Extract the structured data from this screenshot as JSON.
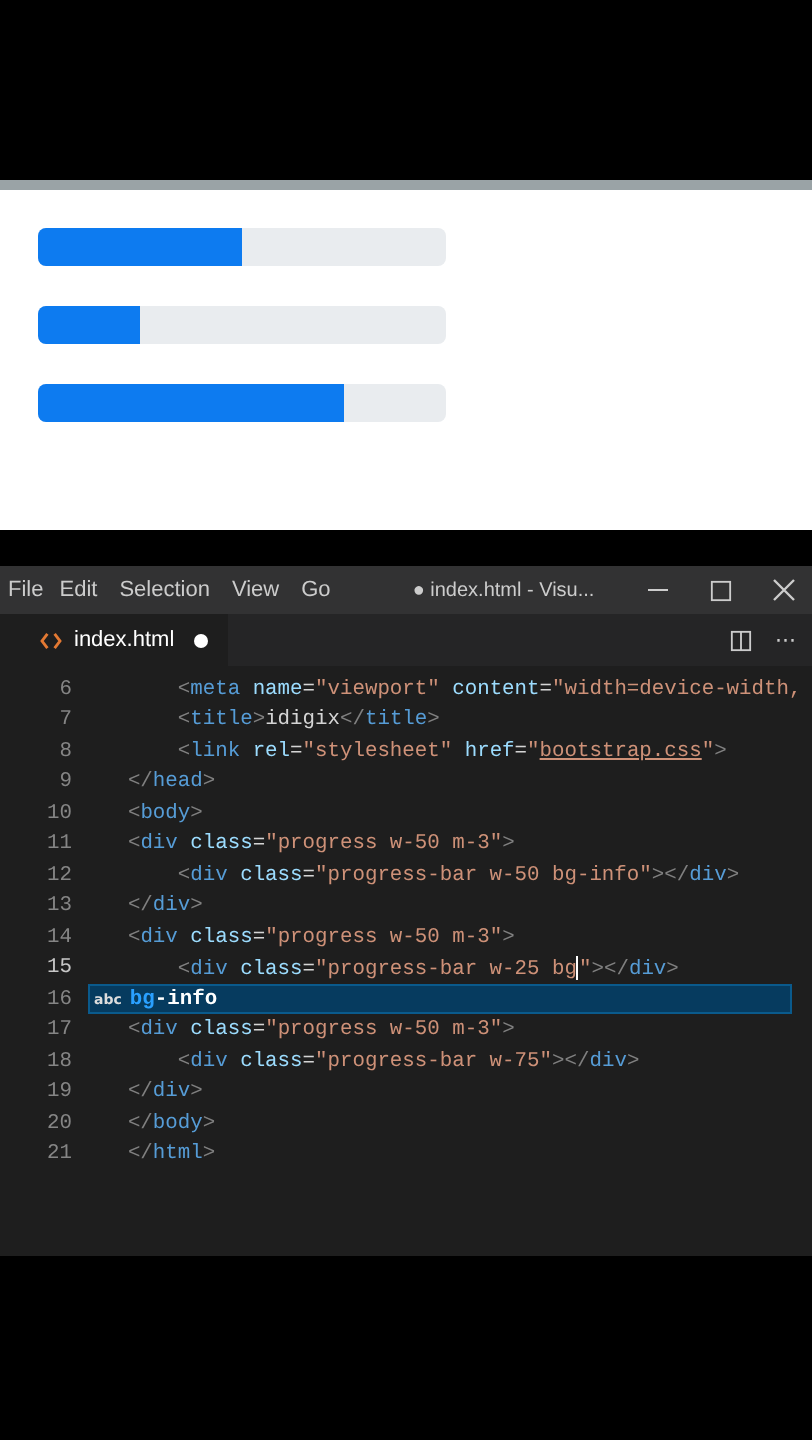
{
  "preview": {
    "progress_bars": [
      {
        "level": 0.5
      },
      {
        "level": 0.25
      },
      {
        "level": 0.75
      }
    ]
  },
  "editor": {
    "menu": [
      "File",
      "Edit",
      "Selection",
      "View",
      "Go"
    ],
    "title": "● index.html - Visu...",
    "tab": {
      "label": "index.html",
      "modified": true,
      "more": "···"
    },
    "lines": [
      {
        "number": "6",
        "segments": [
          {
            "text": "        <",
            "kind": "punct"
          },
          {
            "text": "meta",
            "kind": "tag"
          },
          {
            "text": " name",
            "kind": "attr"
          },
          {
            "text": "=",
            "kind": "text"
          },
          {
            "text": "\"viewport\"",
            "kind": "string"
          },
          {
            "text": " content",
            "kind": "attr"
          },
          {
            "text": "=",
            "kind": "text"
          },
          {
            "text": "\"width=device-width,",
            "kind": "string"
          }
        ]
      },
      {
        "number": "7",
        "segments": [
          {
            "text": "        <",
            "kind": "punct"
          },
          {
            "text": "title",
            "kind": "tag"
          },
          {
            "text": ">",
            "kind": "punct"
          },
          {
            "text": "idigix",
            "kind": "text"
          },
          {
            "text": "</",
            "kind": "punct"
          },
          {
            "text": "title",
            "kind": "tag"
          },
          {
            "text": ">",
            "kind": "punct"
          }
        ]
      },
      {
        "number": "8",
        "segments": [
          {
            "text": "        <",
            "kind": "punct"
          },
          {
            "text": "link",
            "kind": "tag"
          },
          {
            "text": " rel",
            "kind": "attr"
          },
          {
            "text": "=",
            "kind": "text"
          },
          {
            "text": "\"stylesheet\"",
            "kind": "string"
          },
          {
            "text": " href",
            "kind": "attr"
          },
          {
            "text": "=",
            "kind": "text"
          },
          {
            "text": "\"",
            "kind": "string"
          },
          {
            "text": "bootstrap.css",
            "kind": "link"
          },
          {
            "text": "\"",
            "kind": "string"
          },
          {
            "text": ">",
            "kind": "punct"
          }
        ]
      },
      {
        "number": "9",
        "segments": [
          {
            "text": "    </",
            "kind": "punct"
          },
          {
            "text": "head",
            "kind": "tag"
          },
          {
            "text": ">",
            "kind": "punct"
          }
        ]
      },
      {
        "number": "10",
        "segments": [
          {
            "text": "    <",
            "kind": "punct"
          },
          {
            "text": "body",
            "kind": "tag"
          },
          {
            "text": ">",
            "kind": "punct"
          }
        ]
      },
      {
        "number": "11",
        "segments": [
          {
            "text": "    <",
            "kind": "punct"
          },
          {
            "text": "div",
            "kind": "tag"
          },
          {
            "text": " class",
            "kind": "attr"
          },
          {
            "text": "=",
            "kind": "text"
          },
          {
            "text": "\"progress w-50 m-3\"",
            "kind": "string"
          },
          {
            "text": ">",
            "kind": "punct"
          }
        ]
      },
      {
        "number": "12",
        "segments": [
          {
            "text": "        <",
            "kind": "punct"
          },
          {
            "text": "div",
            "kind": "tag"
          },
          {
            "text": " class",
            "kind": "attr"
          },
          {
            "text": "=",
            "kind": "text"
          },
          {
            "text": "\"progress-bar w-50 bg-info\"",
            "kind": "string"
          },
          {
            "text": "></",
            "kind": "punct"
          },
          {
            "text": "div",
            "kind": "tag"
          },
          {
            "text": ">",
            "kind": "punct"
          }
        ]
      },
      {
        "number": "13",
        "segments": [
          {
            "text": "    </",
            "kind": "punct"
          },
          {
            "text": "div",
            "kind": "tag"
          },
          {
            "text": ">",
            "kind": "punct"
          }
        ]
      },
      {
        "number": "14",
        "segments": [
          {
            "text": "    <",
            "kind": "punct"
          },
          {
            "text": "div",
            "kind": "tag"
          },
          {
            "text": " class",
            "kind": "attr"
          },
          {
            "text": "=",
            "kind": "text"
          },
          {
            "text": "\"progress w-50 m-3\"",
            "kind": "string"
          },
          {
            "text": ">",
            "kind": "punct"
          }
        ]
      },
      {
        "number": "15",
        "current": true,
        "segments": [
          {
            "text": "        <",
            "kind": "punct"
          },
          {
            "text": "div",
            "kind": "tag"
          },
          {
            "text": " class",
            "kind": "attr"
          },
          {
            "text": "=",
            "kind": "text"
          },
          {
            "text": "\"progress-bar w-25 bg",
            "kind": "string",
            "caret_after": true
          },
          {
            "text": "\"",
            "kind": "string"
          },
          {
            "text": ">",
            "kind": "punct"
          },
          {
            "text": "</",
            "kind": "punct"
          },
          {
            "text": "div",
            "kind": "tag"
          },
          {
            "text": ">",
            "kind": "punct"
          }
        ]
      },
      {
        "number": "16",
        "suggestion": {
          "icon": "abc",
          "match": "bg",
          "rest": "-info"
        }
      },
      {
        "number": "17",
        "segments": [
          {
            "text": "    <",
            "kind": "punct"
          },
          {
            "text": "div",
            "kind": "tag"
          },
          {
            "text": " class",
            "kind": "attr"
          },
          {
            "text": "=",
            "kind": "text"
          },
          {
            "text": "\"progress w-50 m-3\"",
            "kind": "string"
          },
          {
            "text": ">",
            "kind": "punct"
          }
        ]
      },
      {
        "number": "18",
        "segments": [
          {
            "text": "        <",
            "kind": "punct"
          },
          {
            "text": "div",
            "kind": "tag"
          },
          {
            "text": " class",
            "kind": "attr"
          },
          {
            "text": "=",
            "kind": "text"
          },
          {
            "text": "\"progress-bar w-75\"",
            "kind": "string"
          },
          {
            "text": "></",
            "kind": "punct"
          },
          {
            "text": "div",
            "kind": "tag"
          },
          {
            "text": ">",
            "kind": "punct"
          }
        ]
      },
      {
        "number": "19",
        "segments": [
          {
            "text": "    </",
            "kind": "punct"
          },
          {
            "text": "div",
            "kind": "tag"
          },
          {
            "text": ">",
            "kind": "punct"
          }
        ]
      },
      {
        "number": "20",
        "segments": [
          {
            "text": "    </",
            "kind": "punct"
          },
          {
            "text": "body",
            "kind": "tag"
          },
          {
            "text": ">",
            "kind": "punct"
          }
        ]
      },
      {
        "number": "21",
        "segments": [
          {
            "text": "    </",
            "kind": "punct"
          },
          {
            "text": "html",
            "kind": "tag"
          },
          {
            "text": ">",
            "kind": "punct"
          }
        ]
      }
    ]
  }
}
